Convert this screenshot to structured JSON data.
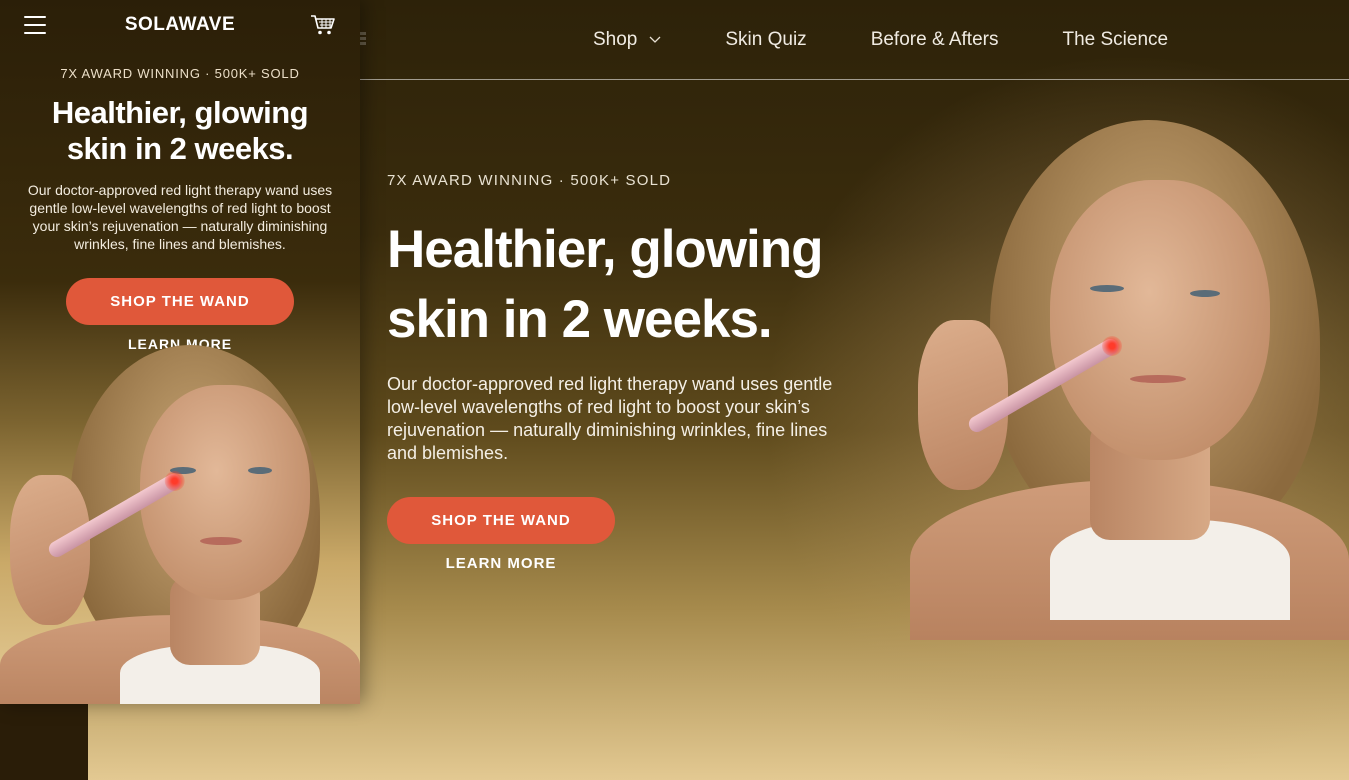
{
  "desktop": {
    "nav": {
      "links": [
        {
          "label": "Shop",
          "has_dropdown": true
        },
        {
          "label": "Skin Quiz"
        },
        {
          "label": "Before & Afters"
        },
        {
          "label": "The Science"
        }
      ]
    },
    "hero": {
      "eyebrow": "7X AWARD WINNING · 500K+ SOLD",
      "title_line1": "Healthier, glowing",
      "title_line2": "skin in 2 weeks.",
      "description": "Our doctor-approved red light therapy wand uses gentle low-level wavelengths of red light to boost your skin’s rejuvenation — naturally diminishing wrinkles, fine lines and blemishes.",
      "primary_cta": "SHOP THE WAND",
      "secondary_cta": "LEARN MORE"
    }
  },
  "mobile": {
    "header": {
      "logo": "SOLAWAVE",
      "menu_icon": "hamburger-icon",
      "cart_icon": "cart-icon"
    },
    "hero": {
      "eyebrow": "7X AWARD WINNING · 500K+ SOLD",
      "title_line1": "Healthier, glowing",
      "title_line2": "skin in 2 weeks.",
      "description": "Our doctor-approved red light therapy wand uses gentle low-level wavelengths of red light to boost your skin’s rejuvenation — naturally diminishing wrinkles, fine lines and blemishes.",
      "primary_cta": "SHOP THE WAND",
      "secondary_cta": "LEARN MORE"
    }
  },
  "colors": {
    "accent": "#e0583a",
    "text_light": "#ffffff",
    "background_dark": "#2d2209",
    "background_gold": "#e3c992"
  }
}
